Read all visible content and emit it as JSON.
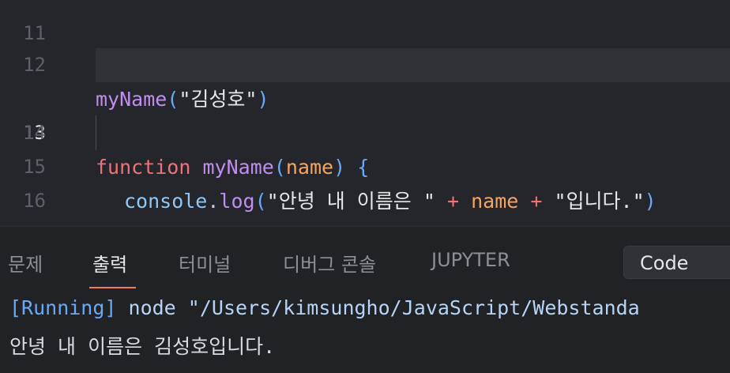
{
  "editor": {
    "partial_line_number": "11",
    "lines": [
      {
        "num": "12"
      },
      {
        "num": "13"
      },
      {
        "num": "14"
      },
      {
        "num": "15"
      },
      {
        "num": "16"
      }
    ],
    "line12": {
      "fn": "myName",
      "open": "(",
      "str": "\"김성호\"",
      "close": ")"
    },
    "line14": {
      "kw": "function",
      "fn": "myName",
      "open": "(",
      "param": "name",
      "close": ")",
      "brace": "{"
    },
    "line15": {
      "obj": "console",
      "dot": ".",
      "method": "log",
      "open": "(",
      "str1": "\"안녕 내 이름은 \"",
      "plus1": "+",
      "var": "name",
      "plus2": "+",
      "str2": "\"입니다.\"",
      "close": ")"
    },
    "line16": {
      "brace": "}"
    }
  },
  "panel": {
    "tabs": [
      "문제",
      "출력",
      "터미널",
      "디버그 콘솔",
      "JUPYTER"
    ],
    "active_tab": "출력",
    "dropdown_value": "Code",
    "output": {
      "running_tag": "[Running]",
      "command": "node \"/Users/kimsungho/JavaScript/Webstanda",
      "result": "안녕 내 이름은 김성호입니다."
    }
  },
  "colors": {
    "editor_bg": "#24262b",
    "panel_bg": "#202226",
    "keyword": "#f07178",
    "function": "#c18ef0",
    "param": "#f4a660",
    "tab_accent": "#f07d54"
  }
}
